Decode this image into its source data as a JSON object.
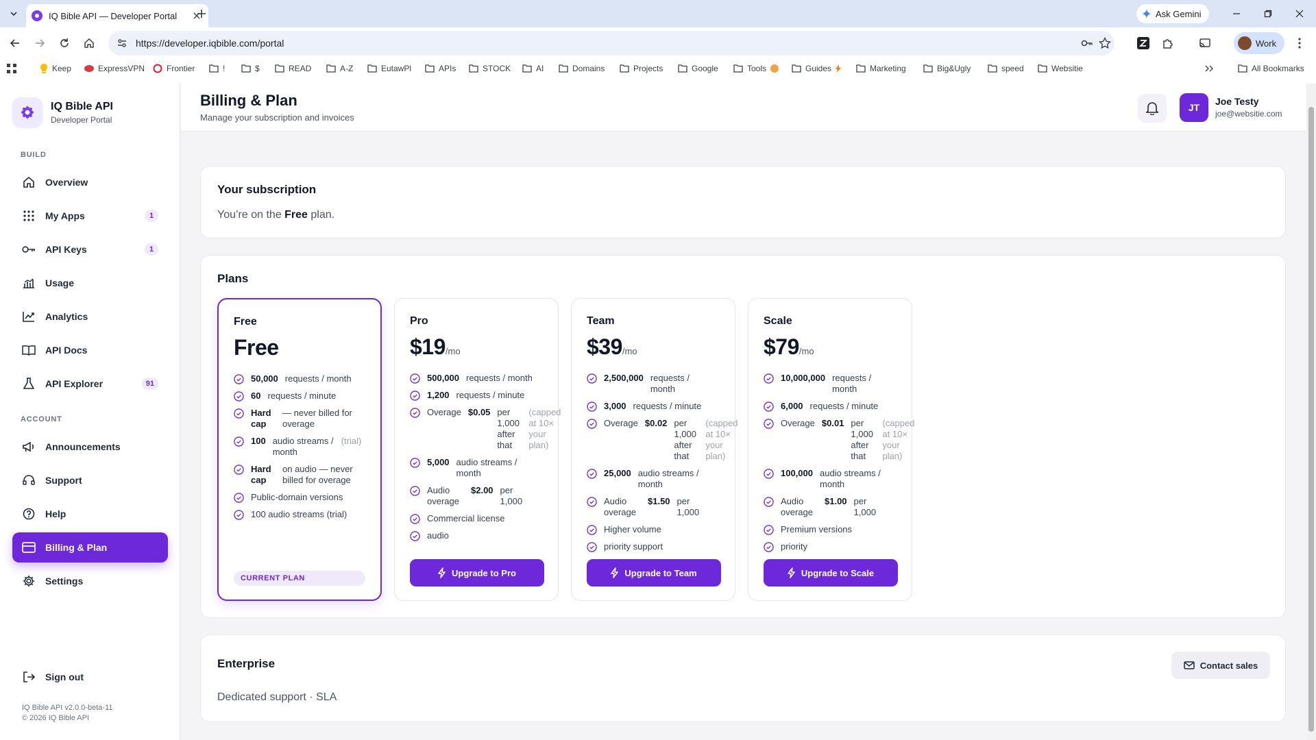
{
  "browser": {
    "tab_title": "IQ Bible API — Developer Portal",
    "url": "https://developer.iqbible.com/portal",
    "ask_gemini": "Ask Gemini",
    "profile_name": "Work",
    "bookmarks": [
      "Keep",
      "ExpressVPN",
      "Frontier",
      "!",
      "$",
      "READ",
      "A-Z",
      "EutawPl",
      "APIs",
      "STOCK",
      "AI",
      "Domains",
      "Projects",
      "Google",
      "Tools",
      "Guides",
      "Marketing",
      "Big&Ugly",
      "speed",
      "Websitie"
    ],
    "all_bookmarks": "All Bookmarks"
  },
  "brand": {
    "name": "IQ Bible API",
    "subtitle": "Developer Portal"
  },
  "sidebar": {
    "build_label": "BUILD",
    "account_label": "ACCOUNT",
    "build_items": [
      {
        "label": "Overview",
        "icon": "home-icon"
      },
      {
        "label": "My Apps",
        "icon": "grid-icon",
        "badge": "1"
      },
      {
        "label": "API Keys",
        "icon": "key-icon",
        "badge": "1"
      },
      {
        "label": "Usage",
        "icon": "chart-icon"
      },
      {
        "label": "Analytics",
        "icon": "trend-icon"
      },
      {
        "label": "API Docs",
        "icon": "book-icon"
      },
      {
        "label": "API Explorer",
        "icon": "flask-icon",
        "badge": "91"
      }
    ],
    "account_items": [
      {
        "label": "Announcements",
        "icon": "megaphone-icon"
      },
      {
        "label": "Support",
        "icon": "headset-icon"
      },
      {
        "label": "Help",
        "icon": "help-icon"
      },
      {
        "label": "Billing & Plan",
        "icon": "card-icon",
        "active": true
      },
      {
        "label": "Settings",
        "icon": "gear-icon"
      }
    ],
    "sign_out": "Sign out",
    "version": "IQ Bible API v2.0.0-beta-11",
    "copyright": "© 2026 IQ Bible API"
  },
  "header": {
    "title": "Billing & Plan",
    "subtitle": "Manage your subscription and invoices",
    "user_initials": "JT",
    "user_name": "Joe Testy",
    "user_email": "joe@websitie.com"
  },
  "subscription": {
    "title": "Your subscription",
    "text_prefix": "You’re on the ",
    "plan": "Free",
    "text_suffix": " plan."
  },
  "plans_title": "Plans",
  "plans": [
    {
      "name": "Free",
      "price": "Free",
      "per": "",
      "current": true,
      "current_label": "CURRENT PLAN",
      "features": [
        {
          "b": "50,000",
          "t": "requests / month"
        },
        {
          "b": "60",
          "t": "requests / minute"
        },
        {
          "b": "Hard cap",
          "t": "— never billed for overage"
        },
        {
          "b": "100",
          "t": "audio streams / month",
          "m": "(trial)"
        },
        {
          "b": "Hard cap",
          "t": "on audio — never billed for overage"
        },
        {
          "t": "Public-domain versions"
        },
        {
          "t": "100 audio streams (trial)"
        }
      ]
    },
    {
      "name": "Pro",
      "price": "$19",
      "per": "/mo",
      "button": "Upgrade to Pro",
      "features": [
        {
          "b": "500,000",
          "t": "requests / month"
        },
        {
          "b": "1,200",
          "t": "requests / minute"
        },
        {
          "p": "Overage",
          "b": "$0.05",
          "t": "per 1,000 after that",
          "m": "(capped at 10× your plan)"
        },
        {
          "b": "5,000",
          "t": "audio streams / month"
        },
        {
          "p": "Audio overage",
          "b": "$2.00",
          "t": "per 1,000"
        },
        {
          "t": "Commercial license"
        },
        {
          "t": "audio"
        }
      ]
    },
    {
      "name": "Team",
      "price": "$39",
      "per": "/mo",
      "button": "Upgrade to Team",
      "features": [
        {
          "b": "2,500,000",
          "t": "requests / month"
        },
        {
          "b": "3,000",
          "t": "requests / minute"
        },
        {
          "p": "Overage",
          "b": "$0.02",
          "t": "per 1,000 after that",
          "m": "(capped at 10× your plan)"
        },
        {
          "b": "25,000",
          "t": "audio streams / month"
        },
        {
          "p": "Audio overage",
          "b": "$1.50",
          "t": "per 1,000"
        },
        {
          "t": "Higher volume"
        },
        {
          "t": "priority support"
        }
      ]
    },
    {
      "name": "Scale",
      "price": "$79",
      "per": "/mo",
      "button": "Upgrade to Scale",
      "features": [
        {
          "b": "10,000,000",
          "t": "requests / month"
        },
        {
          "b": "6,000",
          "t": "requests / minute"
        },
        {
          "p": "Overage",
          "b": "$0.01",
          "t": "per 1,000 after that",
          "m": "(capped at 10× your plan)"
        },
        {
          "b": "100,000",
          "t": "audio streams / month"
        },
        {
          "p": "Audio overage",
          "b": "$1.00",
          "t": "per 1,000"
        },
        {
          "t": "Premium versions"
        },
        {
          "t": "priority"
        }
      ]
    }
  ],
  "enterprise": {
    "title": "Enterprise",
    "text": "Dedicated support · SLA",
    "button": "Contact sales"
  },
  "colors": {
    "accent": "#6d28d9",
    "accent_light": "#efe9fb",
    "page_bg": "#f4f4f7"
  }
}
